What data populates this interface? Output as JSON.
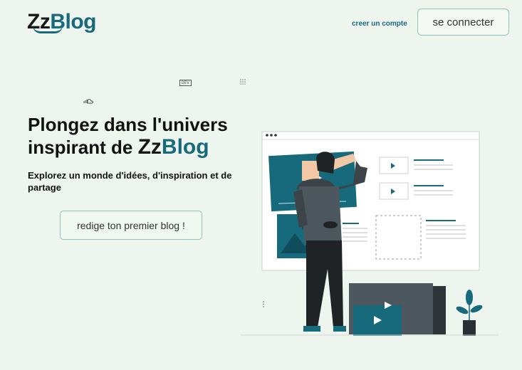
{
  "header": {
    "logo_zz": "Zz",
    "logo_blog": "Blog",
    "create_account": "creer un compte",
    "login": "se connecter"
  },
  "decor": {
    "dev_badge": "DEV"
  },
  "hero": {
    "headline_line1": "Plongez dans l'univers",
    "headline_line2": "inspirant de",
    "brand_zz": "Zz",
    "brand_blog": "Blog",
    "subtitle": "Explorez un monde d'idées, d'inspiration et de partage",
    "cta": "redige ton premier blog !"
  },
  "colors": {
    "accent": "#17697c",
    "background": "#eef4ee",
    "button_border": "#8cc2c0"
  }
}
